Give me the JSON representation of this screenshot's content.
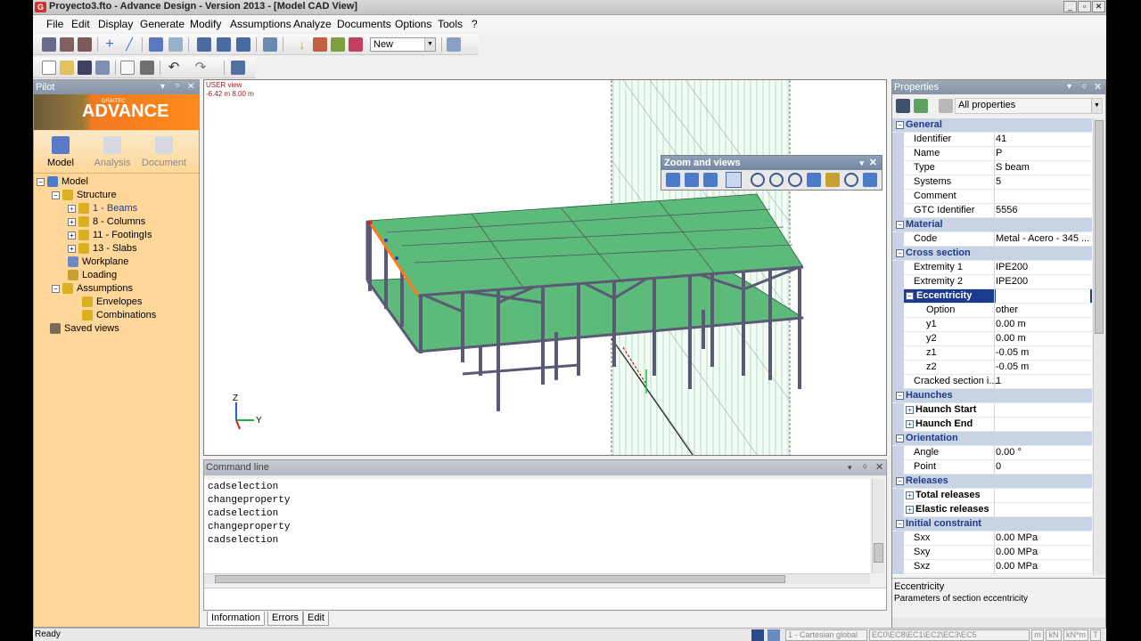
{
  "title": "Proyecto3.fto - Advance Design - Version 2013 - [Model CAD View]",
  "menu": [
    "File",
    "Edit",
    "Display",
    "Generate",
    "Modify",
    "Assumptions",
    "Analyze",
    "Documents",
    "Options",
    "Tools",
    "?"
  ],
  "toolbar": {
    "combo_value": "New"
  },
  "pilot": {
    "title": "Pilot",
    "brand_small": "GRAITEC",
    "brand": "ADVANCE",
    "modes": [
      {
        "label": "Model"
      },
      {
        "label": "Analysis"
      },
      {
        "label": "Document"
      }
    ],
    "tree": [
      {
        "label": "Model"
      },
      {
        "label": "Structure"
      },
      {
        "label": "1 - Beams"
      },
      {
        "label": "8 - Columns"
      },
      {
        "label": "11 - FootingIs"
      },
      {
        "label": "13 - Slabs"
      },
      {
        "label": "Workplane"
      },
      {
        "label": "Loading"
      },
      {
        "label": "Assumptions"
      },
      {
        "label": "Envelopes"
      },
      {
        "label": "Combinations"
      },
      {
        "label": "Saved views"
      }
    ]
  },
  "viewport": {
    "view_name": "USER view",
    "coords": "-6.42 m  8.00 m",
    "axis_z": "Z",
    "axis_y": "Y"
  },
  "zoom": {
    "title": "Zoom and views"
  },
  "command": {
    "title": "Command line",
    "lines": [
      "cadselection",
      "changeproperty",
      "cadselection",
      "changeproperty",
      "cadselection"
    ],
    "tabs": [
      "Information",
      "Errors",
      "Edit"
    ]
  },
  "properties": {
    "title": "Properties",
    "filter": "All properties",
    "rows": [
      {
        "kind": "cat",
        "label": "General"
      },
      {
        "label": "Identifier",
        "value": "41"
      },
      {
        "label": "Name",
        "value": "P"
      },
      {
        "label": "Type",
        "value": "S beam"
      },
      {
        "label": "Systems",
        "value": "5"
      },
      {
        "label": "Comment",
        "value": ""
      },
      {
        "label": "GTC Identifier",
        "value": "5556"
      },
      {
        "kind": "cat",
        "label": "Material"
      },
      {
        "label": "Code",
        "value": "Metal - Acero - 345 ..."
      },
      {
        "kind": "cat",
        "label": "Cross section"
      },
      {
        "label": "Extremity 1",
        "value": "IPE200"
      },
      {
        "label": "Extremity 2",
        "value": "IPE200"
      },
      {
        "kind": "sel",
        "label": "Eccentricity",
        "value": ""
      },
      {
        "label": "Option",
        "value": "other",
        "indent": 1
      },
      {
        "label": "y1",
        "value": "0.00 m",
        "indent": 1
      },
      {
        "label": "y2",
        "value": "0.00 m",
        "indent": 1
      },
      {
        "label": "z1",
        "value": "-0.05 m",
        "indent": 1
      },
      {
        "label": "z2",
        "value": "-0.05 m",
        "indent": 1
      },
      {
        "label": "Cracked section i...",
        "value": "1"
      },
      {
        "kind": "cat",
        "label": "Haunches"
      },
      {
        "kind": "sub",
        "label": "Haunch Start",
        "value": ""
      },
      {
        "kind": "sub",
        "label": "Haunch End",
        "value": ""
      },
      {
        "kind": "cat",
        "label": "Orientation"
      },
      {
        "label": "Angle",
        "value": "0.00 °"
      },
      {
        "label": "Point",
        "value": "0"
      },
      {
        "kind": "cat",
        "label": "Releases"
      },
      {
        "kind": "sub",
        "label": "Total releases",
        "value": ""
      },
      {
        "kind": "sub",
        "label": "Elastic releases",
        "value": ""
      },
      {
        "kind": "cat",
        "label": "Initial constraint"
      },
      {
        "label": "Sxx",
        "value": "0.00 MPa"
      },
      {
        "label": "Sxy",
        "value": "0.00 MPa"
      },
      {
        "label": "Sxz",
        "value": "0.00 MPa"
      }
    ],
    "desc_title": "Eccentricity",
    "desc_text": "Parameters of section eccentricity"
  },
  "status": {
    "text": "Ready",
    "coord_system": "1 - Cartesian global",
    "codes": "EC0\\EC8\\EC1\\EC2\\EC3\\EC5",
    "units": [
      "m",
      "kN",
      "kN*m",
      "T"
    ]
  },
  "colors": {
    "slab": "#5cba7a",
    "frame": "#5a5a74",
    "selected": "#ff7a1a",
    "accent": "#1d3b8c"
  }
}
